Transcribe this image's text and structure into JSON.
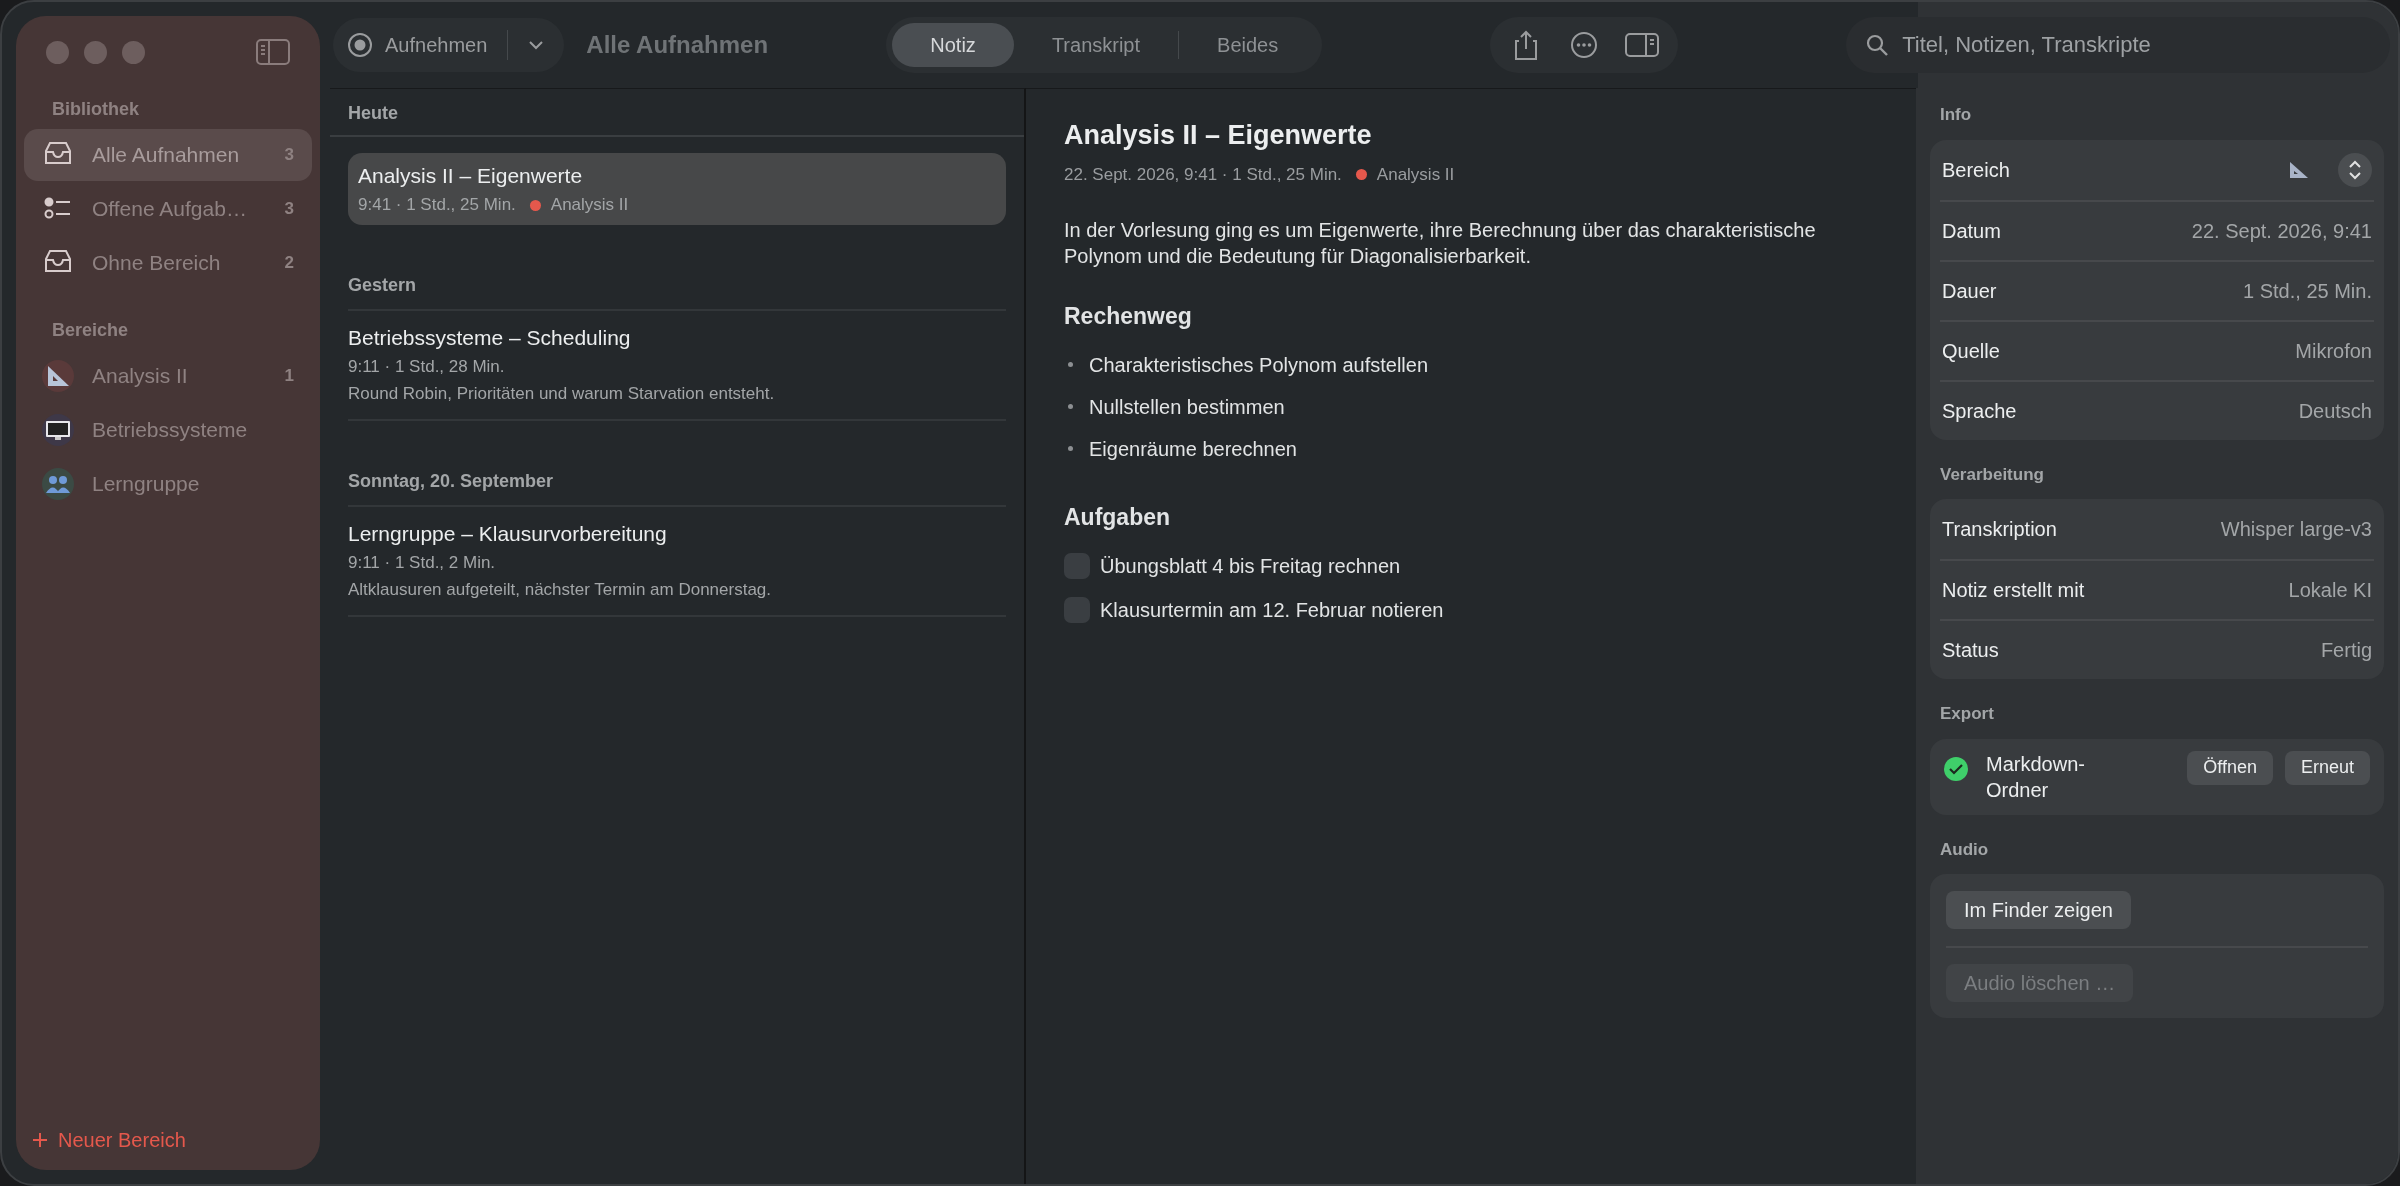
{
  "sidebar": {
    "sections": [
      {
        "title": "Bibliothek",
        "items": [
          {
            "label": "Alle Aufnahmen",
            "count": "3",
            "selected": true,
            "kind": "tray"
          },
          {
            "label": "Offene Aufgab…",
            "count": "3",
            "selected": false,
            "kind": "checklist"
          },
          {
            "label": "Ohne Bereich",
            "count": "2",
            "selected": false,
            "kind": "tray"
          }
        ]
      },
      {
        "title": "Bereiche",
        "items": [
          {
            "label": "Analysis II",
            "count": "1",
            "selected": false,
            "kind": "ruler"
          },
          {
            "label": "Betriebssysteme",
            "selected": false,
            "kind": "monitor"
          },
          {
            "label": "Lerngruppe",
            "selected": false,
            "kind": "people"
          }
        ]
      }
    ],
    "new_button": "Neuer Bereich"
  },
  "toolbar": {
    "record_button": "Aufnehmen",
    "title": "Alle Aufnahmen",
    "view_tabs": [
      {
        "label": "Notiz",
        "selected": true
      },
      {
        "label": "Transkript",
        "selected": false
      },
      {
        "label": "Beides",
        "selected": false
      }
    ],
    "search": {
      "placeholder": "Titel, Notizen, Transkripte"
    }
  },
  "list": {
    "groups": [
      {
        "heading": "Heute",
        "items": [
          {
            "title": "Analysis II – Eigenwerte",
            "meta": "9:41 · 1 Std., 25 Min.",
            "tag": {
              "label": "Analysis II",
              "color": "#e5584c"
            },
            "selected": true
          }
        ]
      },
      {
        "heading": "Gestern",
        "items": [
          {
            "title": "Betriebssysteme – Scheduling",
            "meta": "9:11 · 1 Std., 28 Min.",
            "preview": "Round Robin, Prioritäten und warum Starvation entsteht.",
            "selected": false
          }
        ]
      },
      {
        "heading": "Sonntag, 20. September",
        "items": [
          {
            "title": "Lerngruppe – Klausurvorbereitung",
            "meta": "9:11 · 1 Std., 2 Min.",
            "preview": "Altklausuren aufgeteilt, nächster Termin am Donnerstag.",
            "selected": false
          }
        ]
      }
    ]
  },
  "note": {
    "title": "Analysis II – Eigenwerte",
    "meta": "22. Sept. 2026, 9:41 · 1 Std., 25 Min.",
    "tag": {
      "label": "Analysis II",
      "color": "#e5584c"
    },
    "summary": "In der Vorlesung ging es um Eigenwerte, ihre Berechnung über das charakteristische Polynom und die Bedeutung für Diagonalisierbarkeit.",
    "sections": [
      {
        "heading": "Rechenweg",
        "kind": "bullets",
        "items": [
          {
            "text": "Charakteristisches Polynom aufstellen"
          },
          {
            "text": "Nullstellen bestimmen"
          },
          {
            "text": "Eigenräume berechnen"
          }
        ]
      },
      {
        "heading": "Aufgaben",
        "kind": "tasks",
        "items": [
          {
            "text": "Übungsblatt 4 bis Freitag rechnen",
            "checked": false
          },
          {
            "text": "Klausurtermin am 12. Februar notieren",
            "checked": false
          }
        ]
      }
    ]
  },
  "inspector": {
    "sections": [
      {
        "title": "Info",
        "rows": [
          {
            "label": "Bereich",
            "kind": "picker"
          },
          {
            "label": "Datum",
            "value": "22. Sept. 2026, 9:41",
            "kind": "value"
          },
          {
            "label": "Dauer",
            "value": "1 Std., 25 Min.",
            "kind": "value"
          },
          {
            "label": "Quelle",
            "value": "Mikrofon",
            "kind": "value"
          },
          {
            "label": "Sprache",
            "value": "Deutsch",
            "kind": "value"
          }
        ]
      },
      {
        "title": "Verarbeitung",
        "rows": [
          {
            "label": "Transkription",
            "value": "Whisper large-v3",
            "kind": "value"
          },
          {
            "label": "Notiz erstellt mit",
            "value": "Lokale KI",
            "kind": "value"
          },
          {
            "label": "Status",
            "value": "Fertig",
            "kind": "value"
          }
        ]
      }
    ],
    "export": {
      "title": "Export",
      "label": "Markdown-Ordner",
      "done": true,
      "buttons": [
        "Öffnen",
        "Erneut"
      ]
    },
    "audio": {
      "title": "Audio",
      "buttons": [
        {
          "label": "Im Finder zeigen",
          "disabled": false
        },
        {
          "label": "Audio löschen …",
          "disabled": true
        }
      ]
    }
  }
}
